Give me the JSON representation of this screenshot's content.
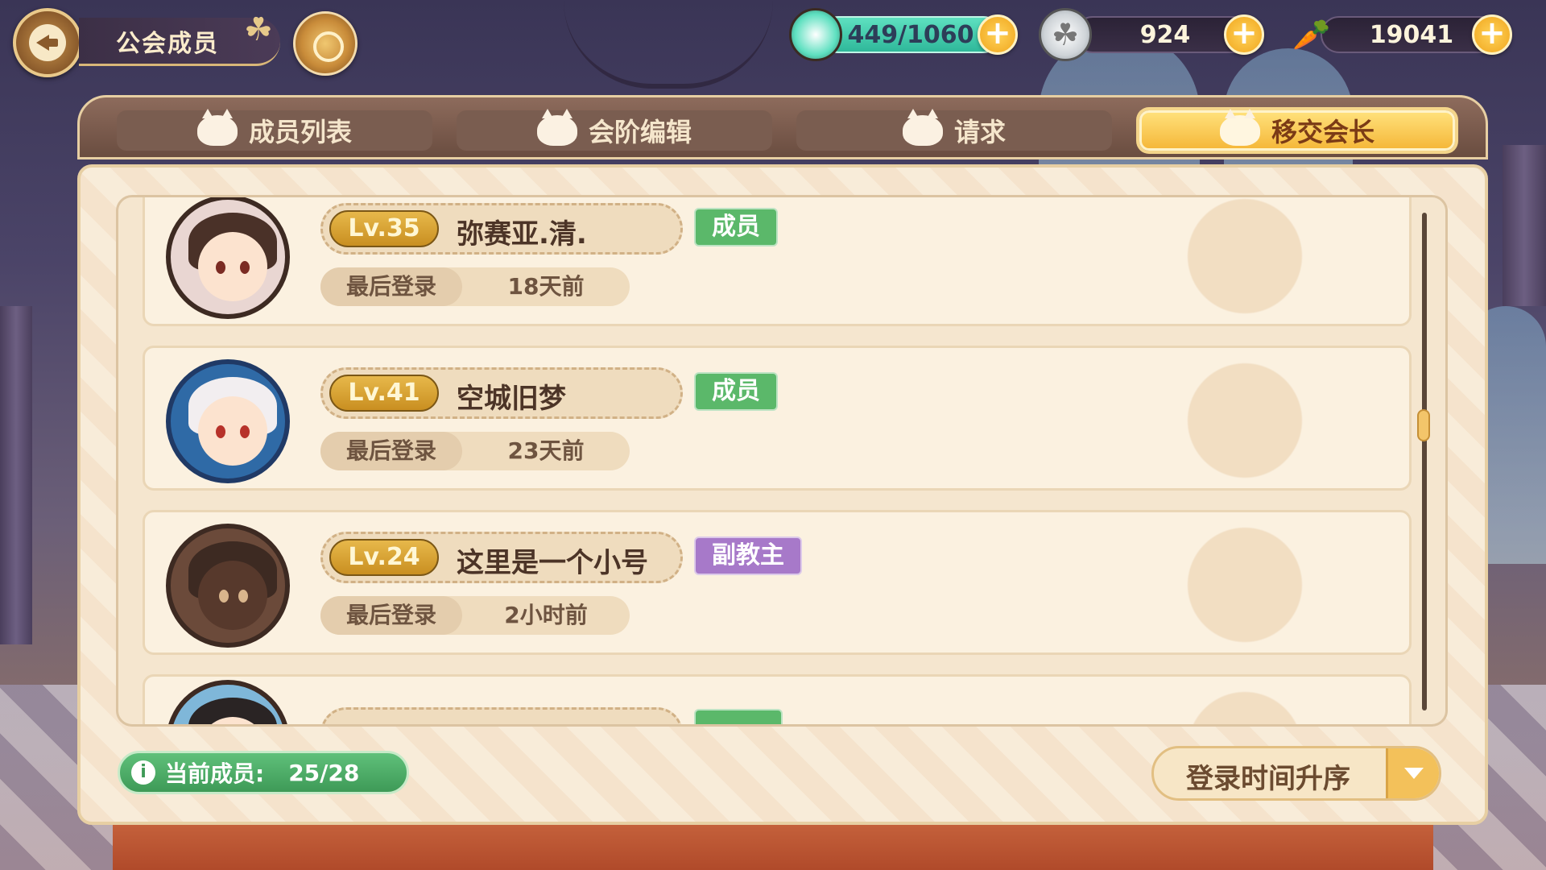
{
  "header": {
    "title": "公会成员",
    "stamina": "449/1060",
    "clover_count": "924",
    "carrot_count": "19041"
  },
  "tabs": [
    {
      "label": "成员列表",
      "active": false
    },
    {
      "label": "会阶编辑",
      "active": false
    },
    {
      "label": "请求",
      "active": false
    },
    {
      "label": "移交会长",
      "active": true
    }
  ],
  "members": [
    {
      "level": "Lv.35",
      "name": "弥赛亚.清.",
      "role": "成员",
      "login_label": "最后登录",
      "login_time": "18天前"
    },
    {
      "level": "Lv.41",
      "name": "空城旧梦",
      "role": "成员",
      "login_label": "最后登录",
      "login_time": "23天前"
    },
    {
      "level": "Lv.24",
      "name": "这里是一个小号",
      "role": "副教主",
      "login_label": "最后登录",
      "login_time": "2小时前"
    }
  ],
  "footer": {
    "member_count_label": "当前成员:",
    "member_count": "25/28",
    "sort_label": "登录时间升序"
  },
  "colors": {
    "role_member": "#5bb86a",
    "role_vice": "#a779c9",
    "active_tab": "#f5b83a"
  }
}
